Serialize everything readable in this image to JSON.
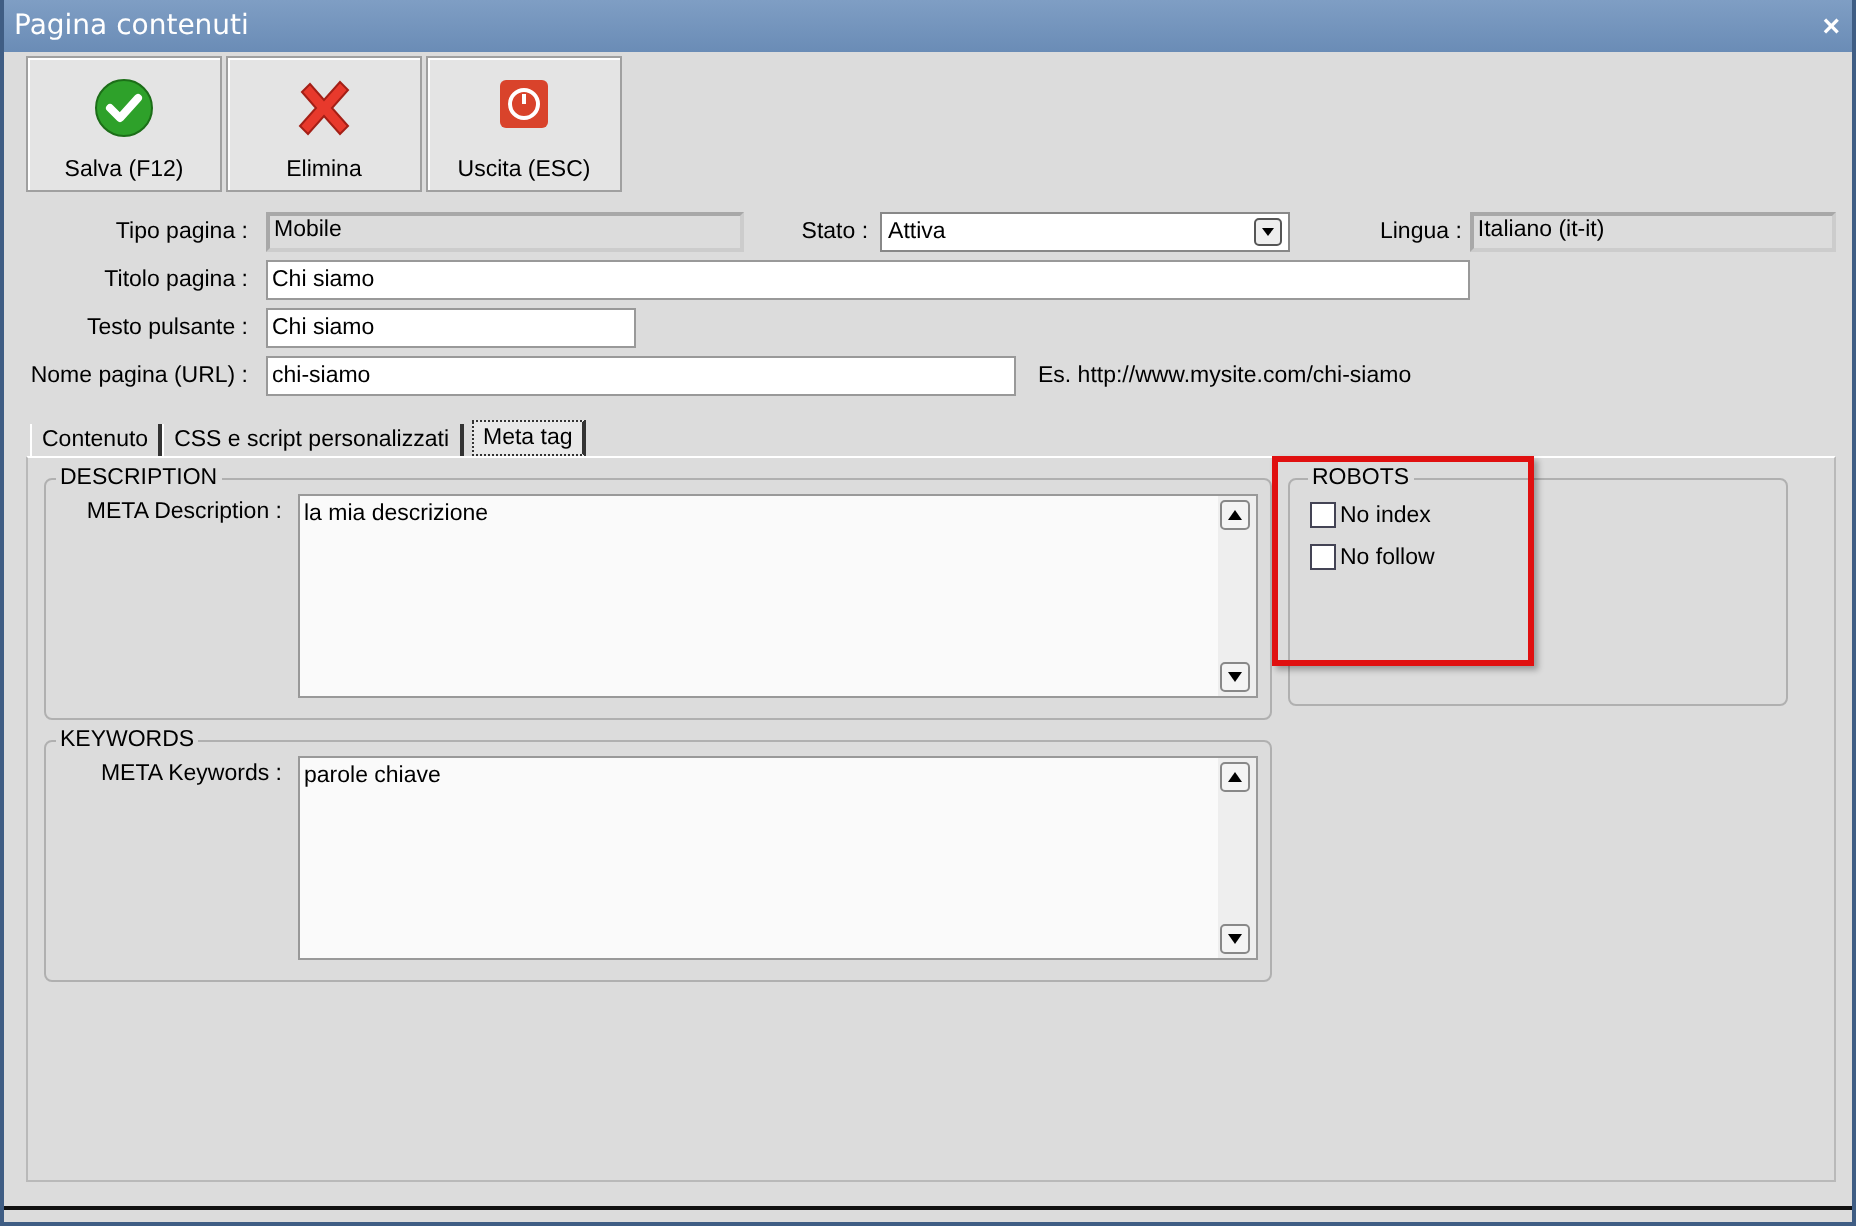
{
  "window": {
    "title": "Pagina contenuti",
    "close": "×"
  },
  "toolbar": [
    {
      "kind": "save",
      "label": "Salva (F12)"
    },
    {
      "kind": "delete",
      "label": "Elimina"
    },
    {
      "kind": "exit",
      "label": "Uscita (ESC)"
    }
  ],
  "form": {
    "tipo_pagina": {
      "label": "Tipo pagina :",
      "value": "Mobile"
    },
    "stato": {
      "label": "Stato :",
      "value": "Attiva"
    },
    "lingua": {
      "label": "Lingua :",
      "value": "Italiano (it-it)"
    },
    "titolo_pagina": {
      "label": "Titolo pagina :",
      "value": "Chi siamo"
    },
    "testo_pulsante": {
      "label": "Testo pulsante :",
      "value": "Chi siamo"
    },
    "nome_pagina": {
      "label": "Nome pagina (URL) :",
      "value": "chi-siamo",
      "hint": "Es. http://www.mysite.com/chi-siamo"
    }
  },
  "tabs": [
    {
      "label": "Contenuto",
      "selected": false
    },
    {
      "label": "CSS e script personalizzati",
      "selected": false
    },
    {
      "label": "Meta tag",
      "selected": true
    }
  ],
  "description": {
    "legend": "DESCRIPTION",
    "label": "META Description :",
    "value": "la mia descrizione"
  },
  "robots": {
    "legend": "ROBOTS",
    "highlighted": true,
    "options": [
      {
        "label": "No index",
        "checked": false
      },
      {
        "label": "No follow",
        "checked": false
      }
    ]
  },
  "keywords": {
    "legend": "KEYWORDS",
    "label": "META Keywords :",
    "value": "parole chiave"
  }
}
